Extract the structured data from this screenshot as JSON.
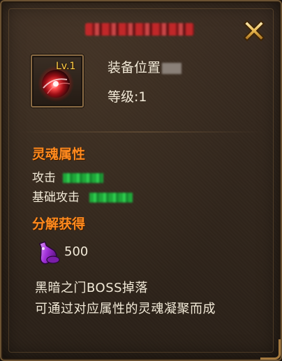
{
  "item": {
    "title": "",
    "level_badge": "Lv.1",
    "equip_position_label": "装备位置",
    "level_text": "等级:1"
  },
  "soul_attributes": {
    "section_title": "灵魂属性",
    "attack_label": "攻击",
    "base_attack_label": "基础攻击"
  },
  "decompose": {
    "section_title": "分解获得",
    "reward_amount": "500",
    "reward_icon": "purple-potion-icon"
  },
  "description": {
    "line1": "黑暗之门BOSS掉落",
    "line2": "可通过对应属性的灵魂凝聚而成"
  },
  "colors": {
    "section_title": "#ff8a1e",
    "level_badge": "#ffd24a",
    "title_red": "#e0332b",
    "stat_value_green": "#2fcf4f"
  }
}
